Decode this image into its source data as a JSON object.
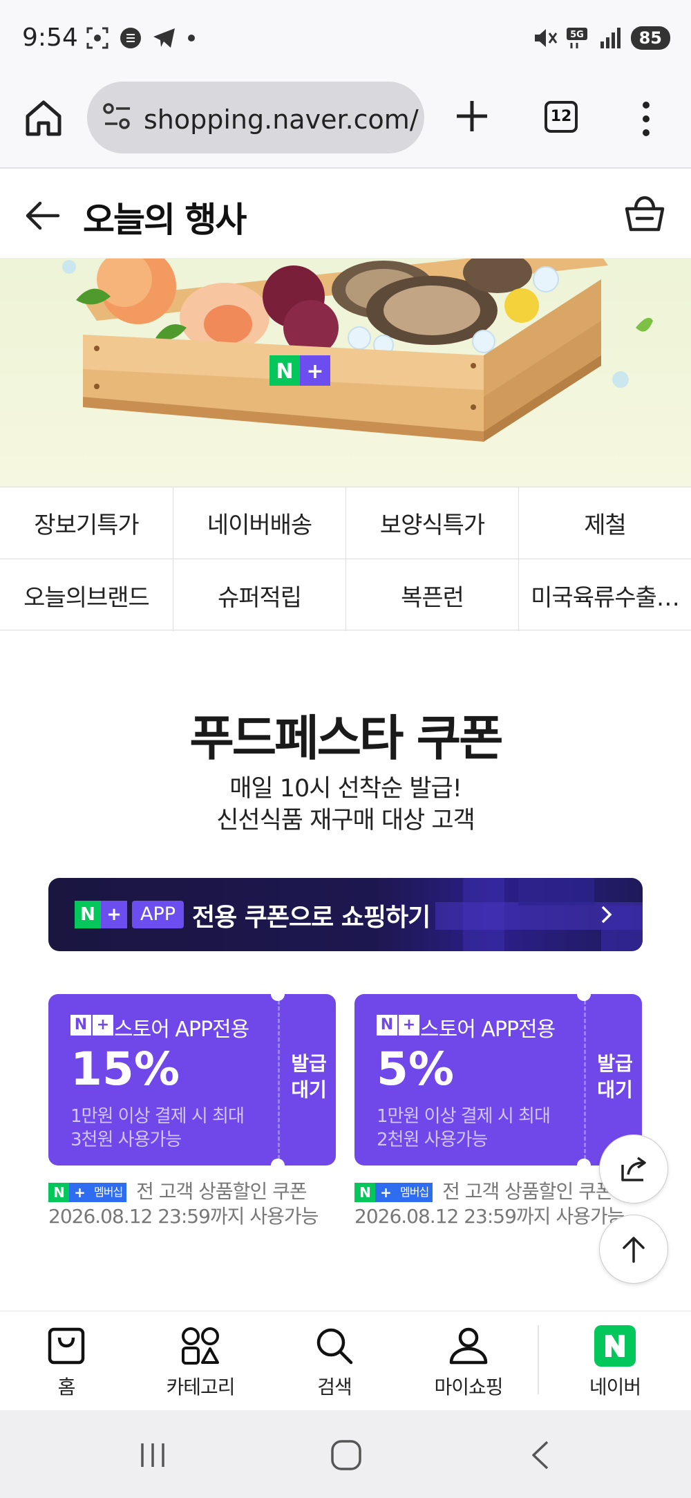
{
  "status_bar": {
    "time": "9:54",
    "battery": "85"
  },
  "browser": {
    "url": "shopping.naver.com/",
    "tab_count": "12"
  },
  "page": {
    "title": "오늘의 행사"
  },
  "banner": {
    "logo_n": "N",
    "logo_plus": "+"
  },
  "categories": [
    "장보기특가",
    "네이버배송",
    "보양식특가",
    "제철",
    "오늘의브랜드",
    "슈퍼적립",
    "복픈런",
    "미국육류수출…"
  ],
  "promo": {
    "title": "푸드페스타 쿠폰",
    "subtitle_line1": "매일 10시 선착순 발급!",
    "subtitle_line2": "신선식품 재구매 대상 고객"
  },
  "app_banner": {
    "n": "N",
    "plus": "+",
    "badge": "APP",
    "text": "전용 쿠폰으로 쇼핑하기"
  },
  "coupons": [
    {
      "store_label": "스토어 APP전용",
      "discount": "15%",
      "desc_line1": "1만원 이상 결제 시 최대",
      "desc_line2": "3천원 사용가능",
      "status_line1": "발급",
      "status_line2": "대기",
      "membership": "멤버십",
      "meta_line1": "전 고객 상품할인 쿠폰",
      "meta_line2": "2026.08.12 23:59까지 사용가능"
    },
    {
      "store_label": "스토어 APP전용",
      "discount": "5%",
      "desc_line1": "1만원 이상 결제 시 최대",
      "desc_line2": "2천원 사용가능",
      "status_line1": "발급",
      "status_line2": "대기",
      "membership": "멤버십",
      "meta_line1": "전 고객 상품할인 쿠폰",
      "meta_line2": "2026.08.12 23:59까지 사용가능"
    }
  ],
  "bottom_nav": [
    {
      "label": "홈",
      "icon": "shopping-bag-icon"
    },
    {
      "label": "카테고리",
      "icon": "category-grid-icon"
    },
    {
      "label": "검색",
      "icon": "search-icon"
    },
    {
      "label": "마이쇼핑",
      "icon": "person-icon"
    },
    {
      "label": "네이버",
      "icon": "naver-n-icon"
    }
  ],
  "colors": {
    "naver_green": "#03c75a",
    "coupon_purple": "#7048ea",
    "plus_purple": "#6c4df0",
    "app_banner_dark": "#1a1640"
  }
}
